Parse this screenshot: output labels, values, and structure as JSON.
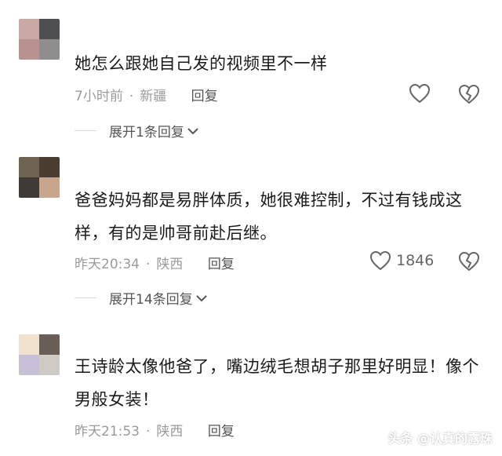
{
  "comments": [
    {
      "text": "她怎么跟她自己发的视频里不一样",
      "time": "7小时前",
      "location": "新疆",
      "reply_label": "回复",
      "likes": "",
      "expand_label": "展开1条回复",
      "avatar_colors": [
        "#c9a9a6",
        "#4f4f52",
        "#b99290",
        "#8e8e8e"
      ]
    },
    {
      "text": "爸爸妈妈都是易胖体质，她很难控制，不过有钱成这样，有的是帅哥前赴后继。",
      "time": "昨天20:34",
      "location": "陕西",
      "reply_label": "回复",
      "likes": "1846",
      "expand_label": "展开14条回复",
      "avatar_colors": [
        "#6e6351",
        "#4a3e33",
        "#3f3a35",
        "#caa58d"
      ]
    },
    {
      "text": "王诗龄太像他爸了，嘴边绒毛想胡子那里好明显！像个男般女装！",
      "time": "昨天21:53",
      "location": "陕西",
      "reply_label": "回复",
      "likes": "",
      "expand_label": "",
      "avatar_colors": [
        "#f0e2cf",
        "#6a5f58",
        "#c8c0d7",
        "#cfcac3"
      ]
    }
  ],
  "watermark": "头条 @认真的露珠",
  "colors": {
    "meta": "#9a9a9a",
    "text": "#1b1b1b",
    "icon": "#666666"
  }
}
